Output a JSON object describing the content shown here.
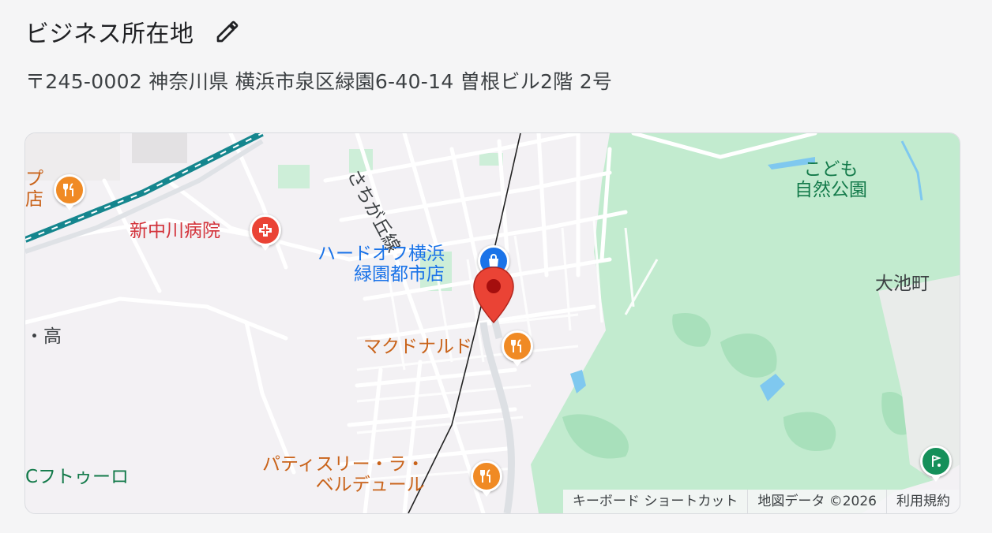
{
  "section": {
    "title": "ビジネス所在地",
    "address": "〒245-0002 神奈川県 横浜市泉区緑園6-40-14 曽根ビル2階 2号"
  },
  "map": {
    "labels": {
      "park": "こども\n自然公園",
      "rail_line": "さちが丘線",
      "town_oike": "大池町",
      "hospital": "新中川病院",
      "hardoff": "ハードオフ横浜\n緑園都市店",
      "mcdonalds": "マクドナルド",
      "patisserie": "パティスリー・ラ・\nベルデュール",
      "partial_left_top": "プ\n店",
      "partial_left_mid": "・高",
      "partial_left_bottom": "Cフトゥーロ"
    },
    "attribution": {
      "keyboard": "キーボード ショートカット",
      "data": "地図データ ©2026",
      "terms": "利用規約"
    },
    "colors": {
      "park": "#c2ebcf",
      "restaurant": "#f08a24",
      "hospital": "#ea4335",
      "shop": "#1a73e8",
      "pin": "#ea4335",
      "rail": "#15868e"
    }
  }
}
